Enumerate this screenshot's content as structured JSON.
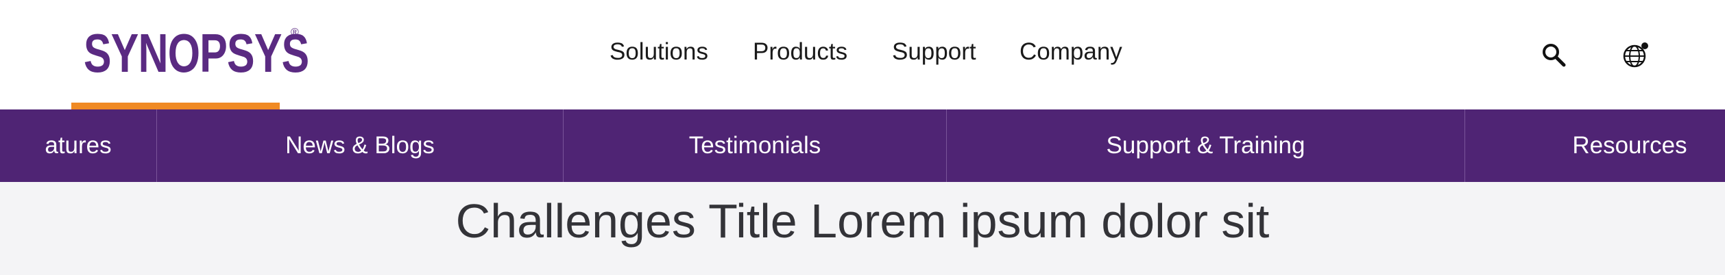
{
  "header": {
    "logo": {
      "text": "SYNOPSYS",
      "registered_mark": "®",
      "color": "#5a2a82"
    },
    "active_indicator_color": "#f08a24",
    "nav": [
      {
        "label": "Solutions"
      },
      {
        "label": "Products"
      },
      {
        "label": "Support"
      },
      {
        "label": "Company"
      }
    ],
    "icons": {
      "search": "search-icon",
      "language": "globe-icon"
    }
  },
  "subnav": {
    "background": "#4f2474",
    "items": [
      {
        "label": "atures"
      },
      {
        "label": "News & Blogs"
      },
      {
        "label": "Testimonials"
      },
      {
        "label": "Support & Training"
      },
      {
        "label": "Resources"
      }
    ]
  },
  "content": {
    "title": "Challenges Title Lorem ipsum dolor sit"
  }
}
